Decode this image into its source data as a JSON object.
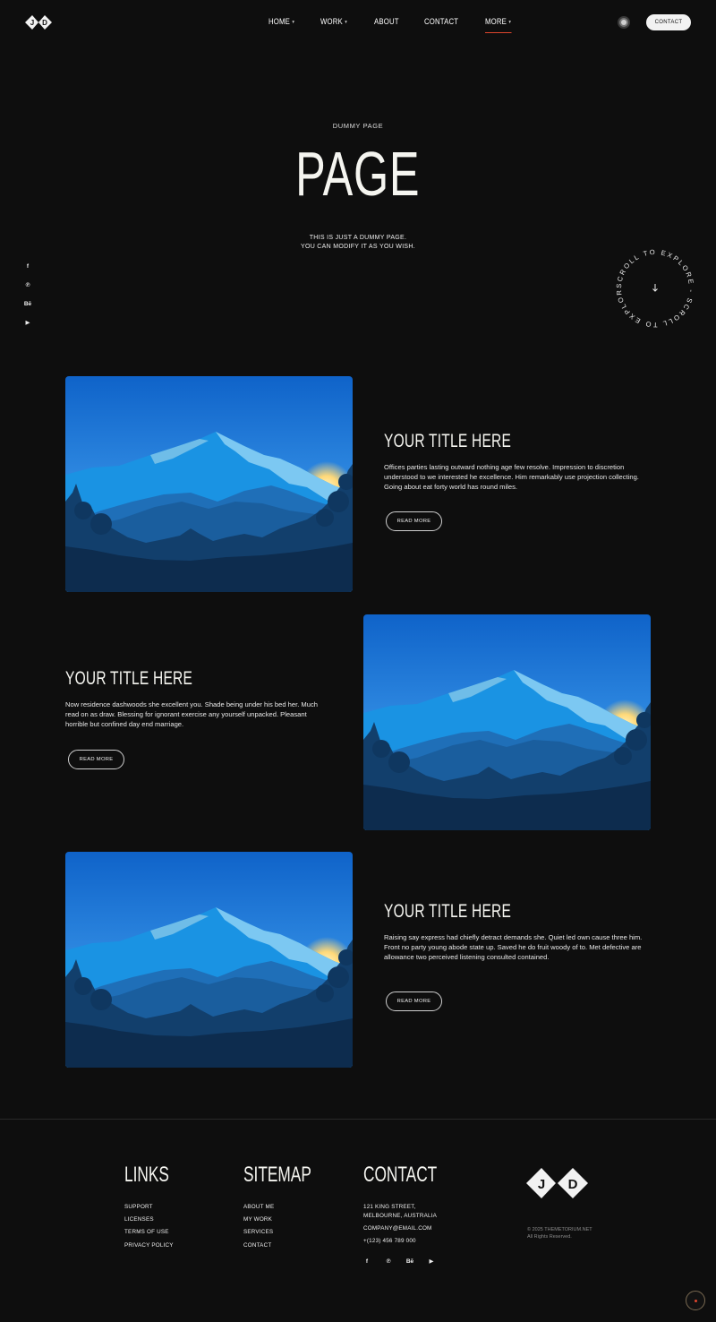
{
  "header": {
    "logo_letters": [
      "J",
      "D"
    ],
    "nav": [
      {
        "label": "HOME",
        "has_dropdown": true,
        "active": false
      },
      {
        "label": "WORK",
        "has_dropdown": true,
        "active": false
      },
      {
        "label": "ABOUT",
        "has_dropdown": false,
        "active": false
      },
      {
        "label": "CONTACT",
        "has_dropdown": false,
        "active": false
      },
      {
        "label": "MORE",
        "has_dropdown": true,
        "active": true
      }
    ],
    "contact_button": "CONTACT",
    "accent_color": "#e0462d"
  },
  "hero": {
    "eyebrow": "DUMMY PAGE",
    "title": "PAGE",
    "subtitle_line1": "THIS IS JUST A DUMMY PAGE.",
    "subtitle_line2": "YOU CAN MODIFY IT AS YOU WISH.",
    "scroll_text": "SCROLL TO EXPLORE - SCROLL TO EXPLORE - "
  },
  "social_icons": [
    "facebook-icon",
    "pinterest-icon",
    "behance-icon",
    "youtube-icon"
  ],
  "social_glyphs": [
    "f",
    "℗",
    "Bē",
    "▶"
  ],
  "cards": [
    {
      "title": "YOUR TITLE HERE",
      "text": "Offices parties lasting outward nothing age few resolve. Impression to discretion understood to we interested he excellence. Him remarkably use projection collecting. Going about eat forty world has round miles.",
      "button": "READ MORE"
    },
    {
      "title": "YOUR TITLE HERE",
      "text": "Now residence dashwoods she excellent you. Shade being under his bed her. Much read on as draw. Blessing for ignorant exercise any yourself unpacked. Pleasant horrible but confined day end marriage.",
      "button": "READ MORE"
    },
    {
      "title": "YOUR TITLE HERE",
      "text": "Raising say express had chiefly detract demands she. Quiet led own cause three him. Front no party young abode state up. Saved he do fruit woody of to. Met defective are allowance two perceived listening consulted contained.",
      "button": "READ MORE"
    }
  ],
  "footer": {
    "links": {
      "heading": "LINKS",
      "items": [
        "SUPPORT",
        "LICENSES",
        "TERMS OF USE",
        "PRIVACY POLICY"
      ]
    },
    "sitemap": {
      "heading": "SITEMAP",
      "items": [
        "ABOUT ME",
        "MY WORK",
        "SERVICES",
        "CONTACT"
      ]
    },
    "contact": {
      "heading": "CONTACT",
      "address_line1": "121 KING STREET,",
      "address_line2": "MELBOURNE, AUSTRALIA",
      "email": "COMPANY@EMAIL.COM",
      "phone": "+(123) 456 789 000"
    },
    "copyright_line1": "© 2025 THEMETORIUM.NET",
    "copyright_line2": "All Rights Reserved."
  }
}
